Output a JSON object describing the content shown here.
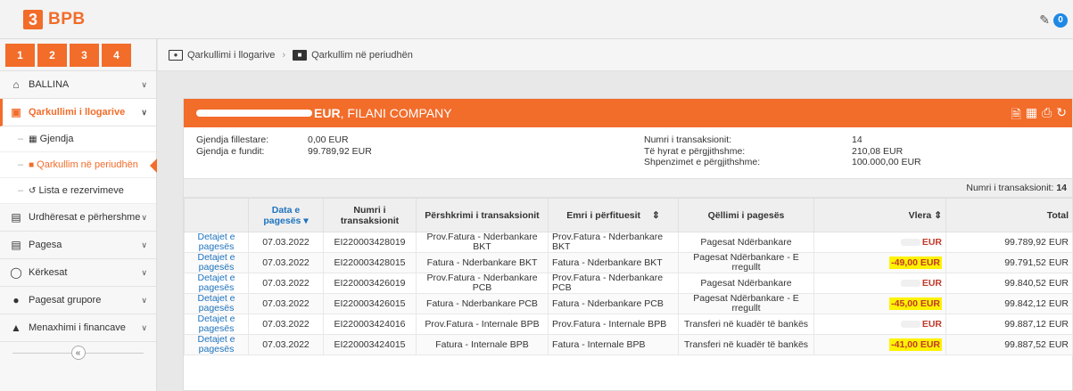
{
  "brand": {
    "logo_mark": "3",
    "name": "BPB"
  },
  "header": {
    "notifications": "0"
  },
  "sidebar": {
    "tabs": [
      "1",
      "2",
      "3",
      "4"
    ],
    "items": [
      {
        "label": "BALLINA",
        "icon": "home-icon"
      },
      {
        "label": "Qarkullimi i llogarive",
        "icon": "account-icon",
        "active": true,
        "children": [
          {
            "label": "Gjendja",
            "icon": "table-icon"
          },
          {
            "label": "Qarkullim në periudhën",
            "icon": "archive-icon",
            "current": true
          },
          {
            "label": "Lista e rezervimeve",
            "icon": "refresh-icon"
          }
        ]
      },
      {
        "label": "Urdhëresat e përhershme",
        "icon": "list-icon"
      },
      {
        "label": "Pagesa",
        "icon": "document-icon"
      },
      {
        "label": "Kërkesat",
        "icon": "circle-icon"
      },
      {
        "label": "Pagesat grupore",
        "icon": "group-icon"
      },
      {
        "label": "Menaxhimi i financave",
        "icon": "chart-icon"
      }
    ],
    "collapse_glyph": "«"
  },
  "breadcrumb": {
    "level1": "Qarkullimi i llogarive",
    "level2": "Qarkullim në periudhën"
  },
  "panel": {
    "account_suffix": "EUR",
    "company": ", FILANI COMPANY"
  },
  "summary": {
    "opening_label": "Gjendja fillestare:",
    "opening_value": "0,00 EUR",
    "closing_label": "Gjendja e fundit:",
    "closing_value": "99.789,92 EUR",
    "tx_count_label": "Numri i transaksionit:",
    "tx_count_value": "14",
    "income_label": "Të hyrat e përgjithshme:",
    "income_value": "210,08 EUR",
    "expense_label": "Shpenzimet e përgjithshme:",
    "expense_value": "100.000,00 EUR"
  },
  "table": {
    "count_label": "Numri i transaksionit:",
    "count_value": "14",
    "columns": {
      "date": "Data e pagesës",
      "number": "Numri i transaksionit",
      "description": "Përshkrimi i transaksionit",
      "beneficiary": "Emri i përfituesit",
      "purpose": "Qëllimi i pagesës",
      "amount": "Vlera",
      "total": "Total"
    },
    "rows": [
      {
        "link": "Detajet e pagesës",
        "date": "07.03.2022",
        "number": "EI220003428019",
        "description": "Prov.Fatura - Nderbankare BKT",
        "beneficiary": "Prov.Fatura - Nderbankare BKT",
        "purpose": "Pagesat Ndërbankare",
        "amount": "EUR",
        "total": "99.789,92 EUR"
      },
      {
        "link": "Detajet e pagesës",
        "date": "07.03.2022",
        "number": "EI220003428015",
        "description": "Fatura - Nderbankare BKT",
        "beneficiary": "Fatura - Nderbankare BKT",
        "purpose": "Pagesat Ndërbankare - E rregullt",
        "amount": "-49,00 EUR",
        "total": "99.791,52 EUR"
      },
      {
        "link": "Detajet e pagesës",
        "date": "07.03.2022",
        "number": "EI220003426019",
        "description": "Prov.Fatura - Nderbankare PCB",
        "beneficiary": "Prov.Fatura - Nderbankare PCB",
        "purpose": "Pagesat Ndërbankare",
        "amount": "EUR",
        "total": "99.840,52 EUR"
      },
      {
        "link": "Detajet e pagesës",
        "date": "07.03.2022",
        "number": "EI220003426015",
        "description": "Fatura - Nderbankare PCB",
        "beneficiary": "Fatura - Nderbankare PCB",
        "purpose": "Pagesat Ndërbankare - E rregullt",
        "amount": "-45,00 EUR",
        "total": "99.842,12 EUR"
      },
      {
        "link": "Detajet e pagesës",
        "date": "07.03.2022",
        "number": "EI220003424016",
        "description": "Prov.Fatura - Internale BPB",
        "beneficiary": "Prov.Fatura - Internale BPB",
        "purpose": "Transferi në kuadër të bankës",
        "amount": "EUR",
        "total": "99.887,12 EUR"
      },
      {
        "link": "Detajet e pagesës",
        "date": "07.03.2022",
        "number": "EI220003424015",
        "description": "Fatura - Internale BPB",
        "beneficiary": "Fatura - Internale BPB",
        "purpose": "Transferi në kuadër të bankës",
        "amount": "-41,00 EUR",
        "total": "99.887,52 EUR"
      }
    ]
  },
  "colors": {
    "brand": "#f26c2a",
    "link": "#1e73be",
    "highlight": "#fff200"
  }
}
